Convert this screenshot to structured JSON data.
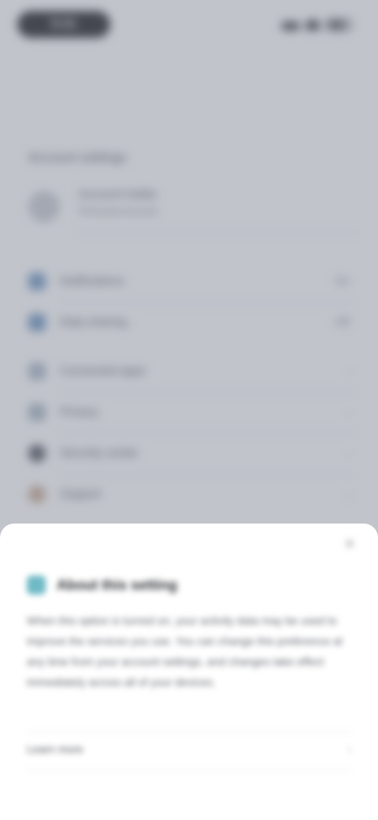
{
  "status_bar": {
    "time": "9:41"
  },
  "settings": {
    "section_title": "Account settings",
    "account": {
      "name": "Account holder",
      "subtitle": "Personal account"
    },
    "items": [
      {
        "label": "Notifications",
        "value": "On",
        "icon": "bell-icon",
        "color": "#6e97c1"
      },
      {
        "label": "Data sharing",
        "value": "Off",
        "icon": "share-icon",
        "color": "#6a93bd"
      },
      {
        "label": "Connected apps",
        "value": "",
        "icon": "link-icon",
        "color": "#a9b7c6"
      },
      {
        "label": "Privacy",
        "value": "",
        "icon": "lock-icon",
        "color": "#a8b6c4"
      },
      {
        "label": "Security center",
        "value": "",
        "icon": "shield-icon",
        "color": "#4a4e5a"
      },
      {
        "label": "Support",
        "value": "",
        "icon": "help-icon",
        "color": "#c6a78f"
      }
    ]
  },
  "sheet": {
    "close_label": "✕",
    "icon": "info-icon",
    "title": "About this setting",
    "body": "When this option is turned on, your activity data may be used to improve the services you use. You can change this preference at any time from your account settings, and changes take effect immediately across all of your devices.",
    "link_label": "Learn more"
  },
  "colors": {
    "overlay": "#767c8c",
    "accent": "#6fb9c6"
  }
}
